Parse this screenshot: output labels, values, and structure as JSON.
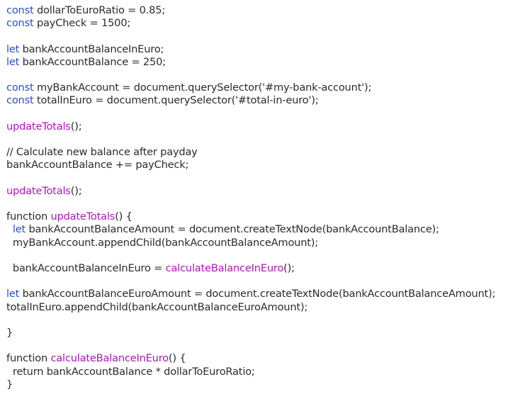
{
  "editor": {
    "lines": [
      {
        "segments": [
          {
            "type": "kw",
            "text": "const"
          },
          {
            "type": "plain",
            "text": " dollarToEuroRatio = 0.85;"
          }
        ]
      },
      {
        "segments": [
          {
            "type": "kw",
            "text": "const"
          },
          {
            "type": "plain",
            "text": " payCheck = 1500;"
          }
        ]
      },
      {
        "segments": []
      },
      {
        "segments": [
          {
            "type": "kw",
            "text": "let"
          },
          {
            "type": "plain",
            "text": " bankAccountBalanceInEuro;"
          }
        ]
      },
      {
        "segments": [
          {
            "type": "kw",
            "text": "let"
          },
          {
            "type": "plain",
            "text": " bankAccountBalance = 250;"
          }
        ]
      },
      {
        "segments": []
      },
      {
        "segments": [
          {
            "type": "kw",
            "text": "const"
          },
          {
            "type": "plain",
            "text": " myBankAccount = document.querySelector('#my-bank-account');"
          }
        ]
      },
      {
        "segments": [
          {
            "type": "kw",
            "text": "const"
          },
          {
            "type": "plain",
            "text": " totalInEuro = document.querySelector('#total-in-euro');"
          }
        ]
      },
      {
        "segments": []
      },
      {
        "segments": [
          {
            "type": "fn",
            "text": "updateTotals"
          },
          {
            "type": "plain",
            "text": "();"
          }
        ]
      },
      {
        "segments": []
      },
      {
        "segments": [
          {
            "type": "plain",
            "text": "// Calculate new balance after payday"
          }
        ]
      },
      {
        "segments": [
          {
            "type": "plain",
            "text": "bankAccountBalance += payCheck;"
          }
        ]
      },
      {
        "segments": []
      },
      {
        "segments": [
          {
            "type": "fn",
            "text": "updateTotals"
          },
          {
            "type": "plain",
            "text": "();"
          }
        ]
      },
      {
        "segments": []
      },
      {
        "segments": [
          {
            "type": "plain",
            "text": "function "
          },
          {
            "type": "fn",
            "text": "updateTotals"
          },
          {
            "type": "plain",
            "text": "() {"
          }
        ]
      },
      {
        "segments": [
          {
            "type": "plain",
            "text": "  "
          },
          {
            "type": "kw",
            "text": "let"
          },
          {
            "type": "plain",
            "text": " bankAccountBalanceAmount = document.createTextNode(bankAccountBalance);"
          }
        ]
      },
      {
        "segments": [
          {
            "type": "plain",
            "text": "  myBankAccount.appendChild(bankAccountBalanceAmount);"
          }
        ]
      },
      {
        "segments": []
      },
      {
        "segments": [
          {
            "type": "plain",
            "text": "  bankAccountBalanceInEuro = "
          },
          {
            "type": "fn",
            "text": "calculateBalanceInEuro"
          },
          {
            "type": "plain",
            "text": "();"
          }
        ]
      },
      {
        "segments": []
      },
      {
        "segments": [
          {
            "type": "kw",
            "text": "let"
          },
          {
            "type": "plain",
            "text": " bankAccountBalanceEuroAmount = document.createTextNode(bankAccountBalanceAmount);"
          }
        ]
      },
      {
        "segments": [
          {
            "type": "plain",
            "text": "totalInEuro.appendChild(bankAccountBalanceEuroAmount);"
          }
        ]
      },
      {
        "segments": []
      },
      {
        "segments": [
          {
            "type": "plain",
            "text": "}"
          }
        ]
      },
      {
        "segments": []
      },
      {
        "segments": [
          {
            "type": "plain",
            "text": "function "
          },
          {
            "type": "fn",
            "text": "calculateBalanceInEuro"
          },
          {
            "type": "plain",
            "text": "() {"
          }
        ]
      },
      {
        "segments": [
          {
            "type": "plain",
            "text": "  return bankAccountBalance * dollarToEuroRatio;"
          }
        ]
      },
      {
        "segments": [
          {
            "type": "plain",
            "text": "}"
          }
        ]
      }
    ],
    "colors": {
      "keyword": "#2a4fbf",
      "function_name": "#a71ab3",
      "text": "#2b2b2b",
      "background": "#ffffff"
    }
  }
}
